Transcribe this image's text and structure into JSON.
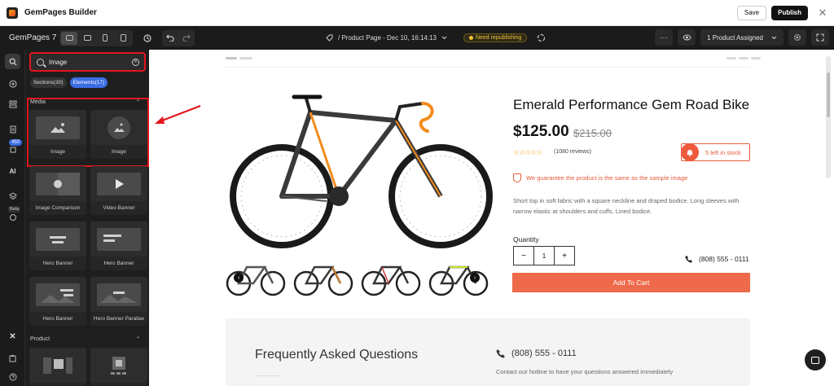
{
  "app": {
    "title": "GemPages Builder",
    "save_label": "Save",
    "publish_label": "Publish",
    "close_glyph": "✕"
  },
  "topbar": {
    "brand": "GemPages 7",
    "page_selector": "/ Product Page - Dec 10, 16:14:13",
    "status_badge": "Need republishing",
    "assigned_label": "1 Product Assigned",
    "more_glyph": "···"
  },
  "rail": {
    "badge_count": "450",
    "ai_label": "AI",
    "beta_label": "Beta"
  },
  "panel": {
    "search": {
      "value": "Image"
    },
    "tabs": [
      {
        "label": "Sections(30)"
      },
      {
        "label": "Elements(17)"
      }
    ],
    "media": {
      "title": "Media",
      "items": [
        "Image",
        "Image",
        "Image Comparison",
        "Video Banner",
        "Hero Banner",
        "Hero Banner",
        "Hero Banner",
        "Hero Banner Parallax"
      ]
    },
    "product": {
      "title": "Product"
    }
  },
  "product": {
    "title": "Emerald Performance Gem Road Bike",
    "price": "$125.00",
    "compare_price": "$215.00",
    "reviews": "(1080 reviews)",
    "rating_stars": "☆☆☆☆☆",
    "stock_text": "5 left in stock",
    "guarantee": "We guarantee the product is the same as the sample image",
    "description": "Short top in soft fabric with a square neckline and draped bodice. Long sleeves with narrow elastic at shoulders and cuffs. Lined bodice.",
    "quantity_label": "Quantity",
    "quantity_value": "1",
    "qty_minus": "−",
    "qty_plus": "+",
    "phone": "(808) 555 - 0111",
    "add_to_cart": "Add To Cart"
  },
  "faq": {
    "title": "Frequently Asked Questions",
    "phone": "(808) 555 - 0111",
    "subtitle": "Contact our hotline to have your questions answered immediately"
  },
  "colors": {
    "accent": "#ee6a4a",
    "highlight": "#e3161b",
    "brand_blue": "#3b6ce3",
    "frame_orange": "#f28c1c"
  }
}
